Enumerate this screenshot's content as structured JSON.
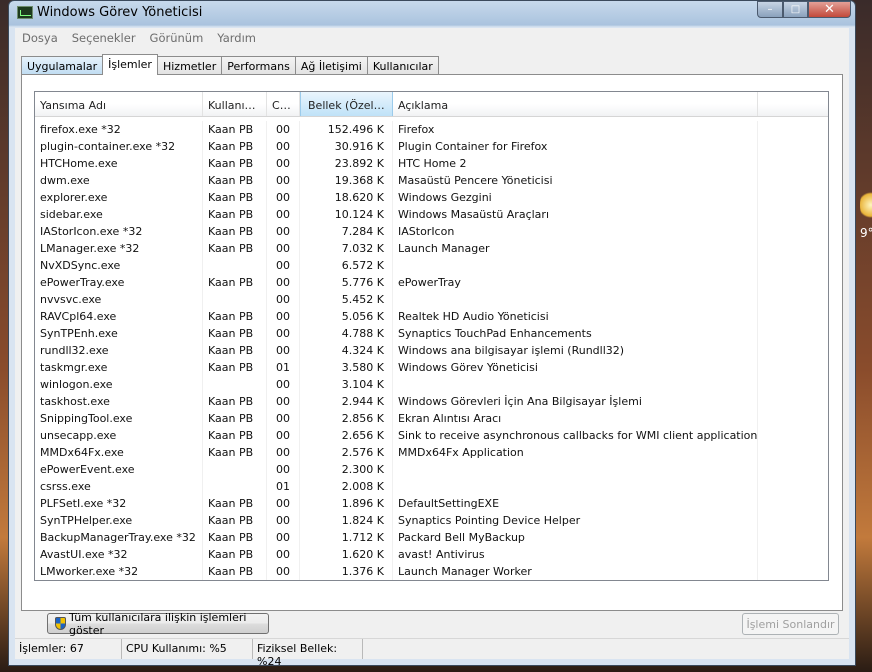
{
  "window": {
    "title": "Windows Görev Yöneticisi"
  },
  "caption": {
    "minimize": "–",
    "maximize": "□",
    "close": "✕"
  },
  "menu": [
    "Dosya",
    "Seçenekler",
    "Görünüm",
    "Yardım"
  ],
  "tabs": [
    "Uygulamalar",
    "İşlemler",
    "Hizmetler",
    "Performans",
    "Ağ İletişimi",
    "Kullanıcılar"
  ],
  "active_tab": "İşlemler",
  "columns": [
    "Yansıma Adı",
    "Kullanıcı ...",
    "CPU",
    "Bellek (Özel Ç...",
    "Açıklama"
  ],
  "rows": [
    [
      "firefox.exe *32",
      "Kaan PB",
      "00",
      "152.496 K",
      "Firefox"
    ],
    [
      "plugin-container.exe *32",
      "Kaan PB",
      "00",
      "30.916 K",
      "Plugin Container for Firefox"
    ],
    [
      "HTCHome.exe",
      "Kaan PB",
      "00",
      "23.892 K",
      "HTC Home 2"
    ],
    [
      "dwm.exe",
      "Kaan PB",
      "00",
      "19.368 K",
      "Masaüstü Pencere Yöneticisi"
    ],
    [
      "explorer.exe",
      "Kaan PB",
      "00",
      "18.620 K",
      "Windows Gezgini"
    ],
    [
      "sidebar.exe",
      "Kaan PB",
      "00",
      "10.124 K",
      "Windows Masaüstü Araçları"
    ],
    [
      "IAStorIcon.exe *32",
      "Kaan PB",
      "00",
      "7.284 K",
      "IAStorIcon"
    ],
    [
      "LManager.exe *32",
      "Kaan PB",
      "00",
      "7.032 K",
      "Launch Manager"
    ],
    [
      "NvXDSync.exe",
      "",
      "00",
      "6.572 K",
      ""
    ],
    [
      "ePowerTray.exe",
      "Kaan PB",
      "00",
      "5.776 K",
      "ePowerTray"
    ],
    [
      "nvvsvc.exe",
      "",
      "00",
      "5.452 K",
      ""
    ],
    [
      "RAVCpl64.exe",
      "Kaan PB",
      "00",
      "5.056 K",
      "Realtek HD Audio Yöneticisi"
    ],
    [
      "SynTPEnh.exe",
      "Kaan PB",
      "00",
      "4.788 K",
      "Synaptics TouchPad Enhancements"
    ],
    [
      "rundll32.exe",
      "Kaan PB",
      "00",
      "4.324 K",
      "Windows ana bilgisayar işlemi (Rundll32)"
    ],
    [
      "taskmgr.exe",
      "Kaan PB",
      "01",
      "3.580 K",
      "Windows Görev Yöneticisi"
    ],
    [
      "winlogon.exe",
      "",
      "00",
      "3.104 K",
      ""
    ],
    [
      "taskhost.exe",
      "Kaan PB",
      "00",
      "2.944 K",
      "Windows Görevleri İçin Ana Bilgisayar İşlemi"
    ],
    [
      "SnippingTool.exe",
      "Kaan PB",
      "00",
      "2.856 K",
      "Ekran Alıntısı Aracı"
    ],
    [
      "unsecapp.exe",
      "Kaan PB",
      "00",
      "2.656 K",
      "Sink to receive asynchronous callbacks for WMI client application"
    ],
    [
      "MMDx64Fx.exe",
      "Kaan PB",
      "00",
      "2.576 K",
      "MMDx64Fx Application"
    ],
    [
      "ePowerEvent.exe",
      "",
      "00",
      "2.300 K",
      ""
    ],
    [
      "csrss.exe",
      "",
      "01",
      "2.008 K",
      ""
    ],
    [
      "PLFSetI.exe *32",
      "Kaan PB",
      "00",
      "1.896 K",
      "DefaultSettingEXE"
    ],
    [
      "SynTPHelper.exe",
      "Kaan PB",
      "00",
      "1.824 K",
      "Synaptics Pointing Device Helper"
    ],
    [
      "BackupManagerTray.exe *32",
      "Kaan PB",
      "00",
      "1.712 K",
      "Packard Bell MyBackup"
    ],
    [
      "AvastUI.exe *32",
      "Kaan PB",
      "00",
      "1.620 K",
      "avast! Antivirus"
    ],
    [
      "LMworker.exe *32",
      "Kaan PB",
      "00",
      "1.376 K",
      "Launch Manager Worker"
    ]
  ],
  "buttons": {
    "show_all": "Tüm kullanıcılara ilişkin işlemleri göster",
    "end_process": "İşlemi Sonlandır"
  },
  "status": {
    "processes": "İşlemler: 67",
    "cpu": "CPU Kullanımı: %5",
    "memory": "Fiziksel Bellek: %24"
  },
  "desktop": {
    "side_text": "9°"
  }
}
